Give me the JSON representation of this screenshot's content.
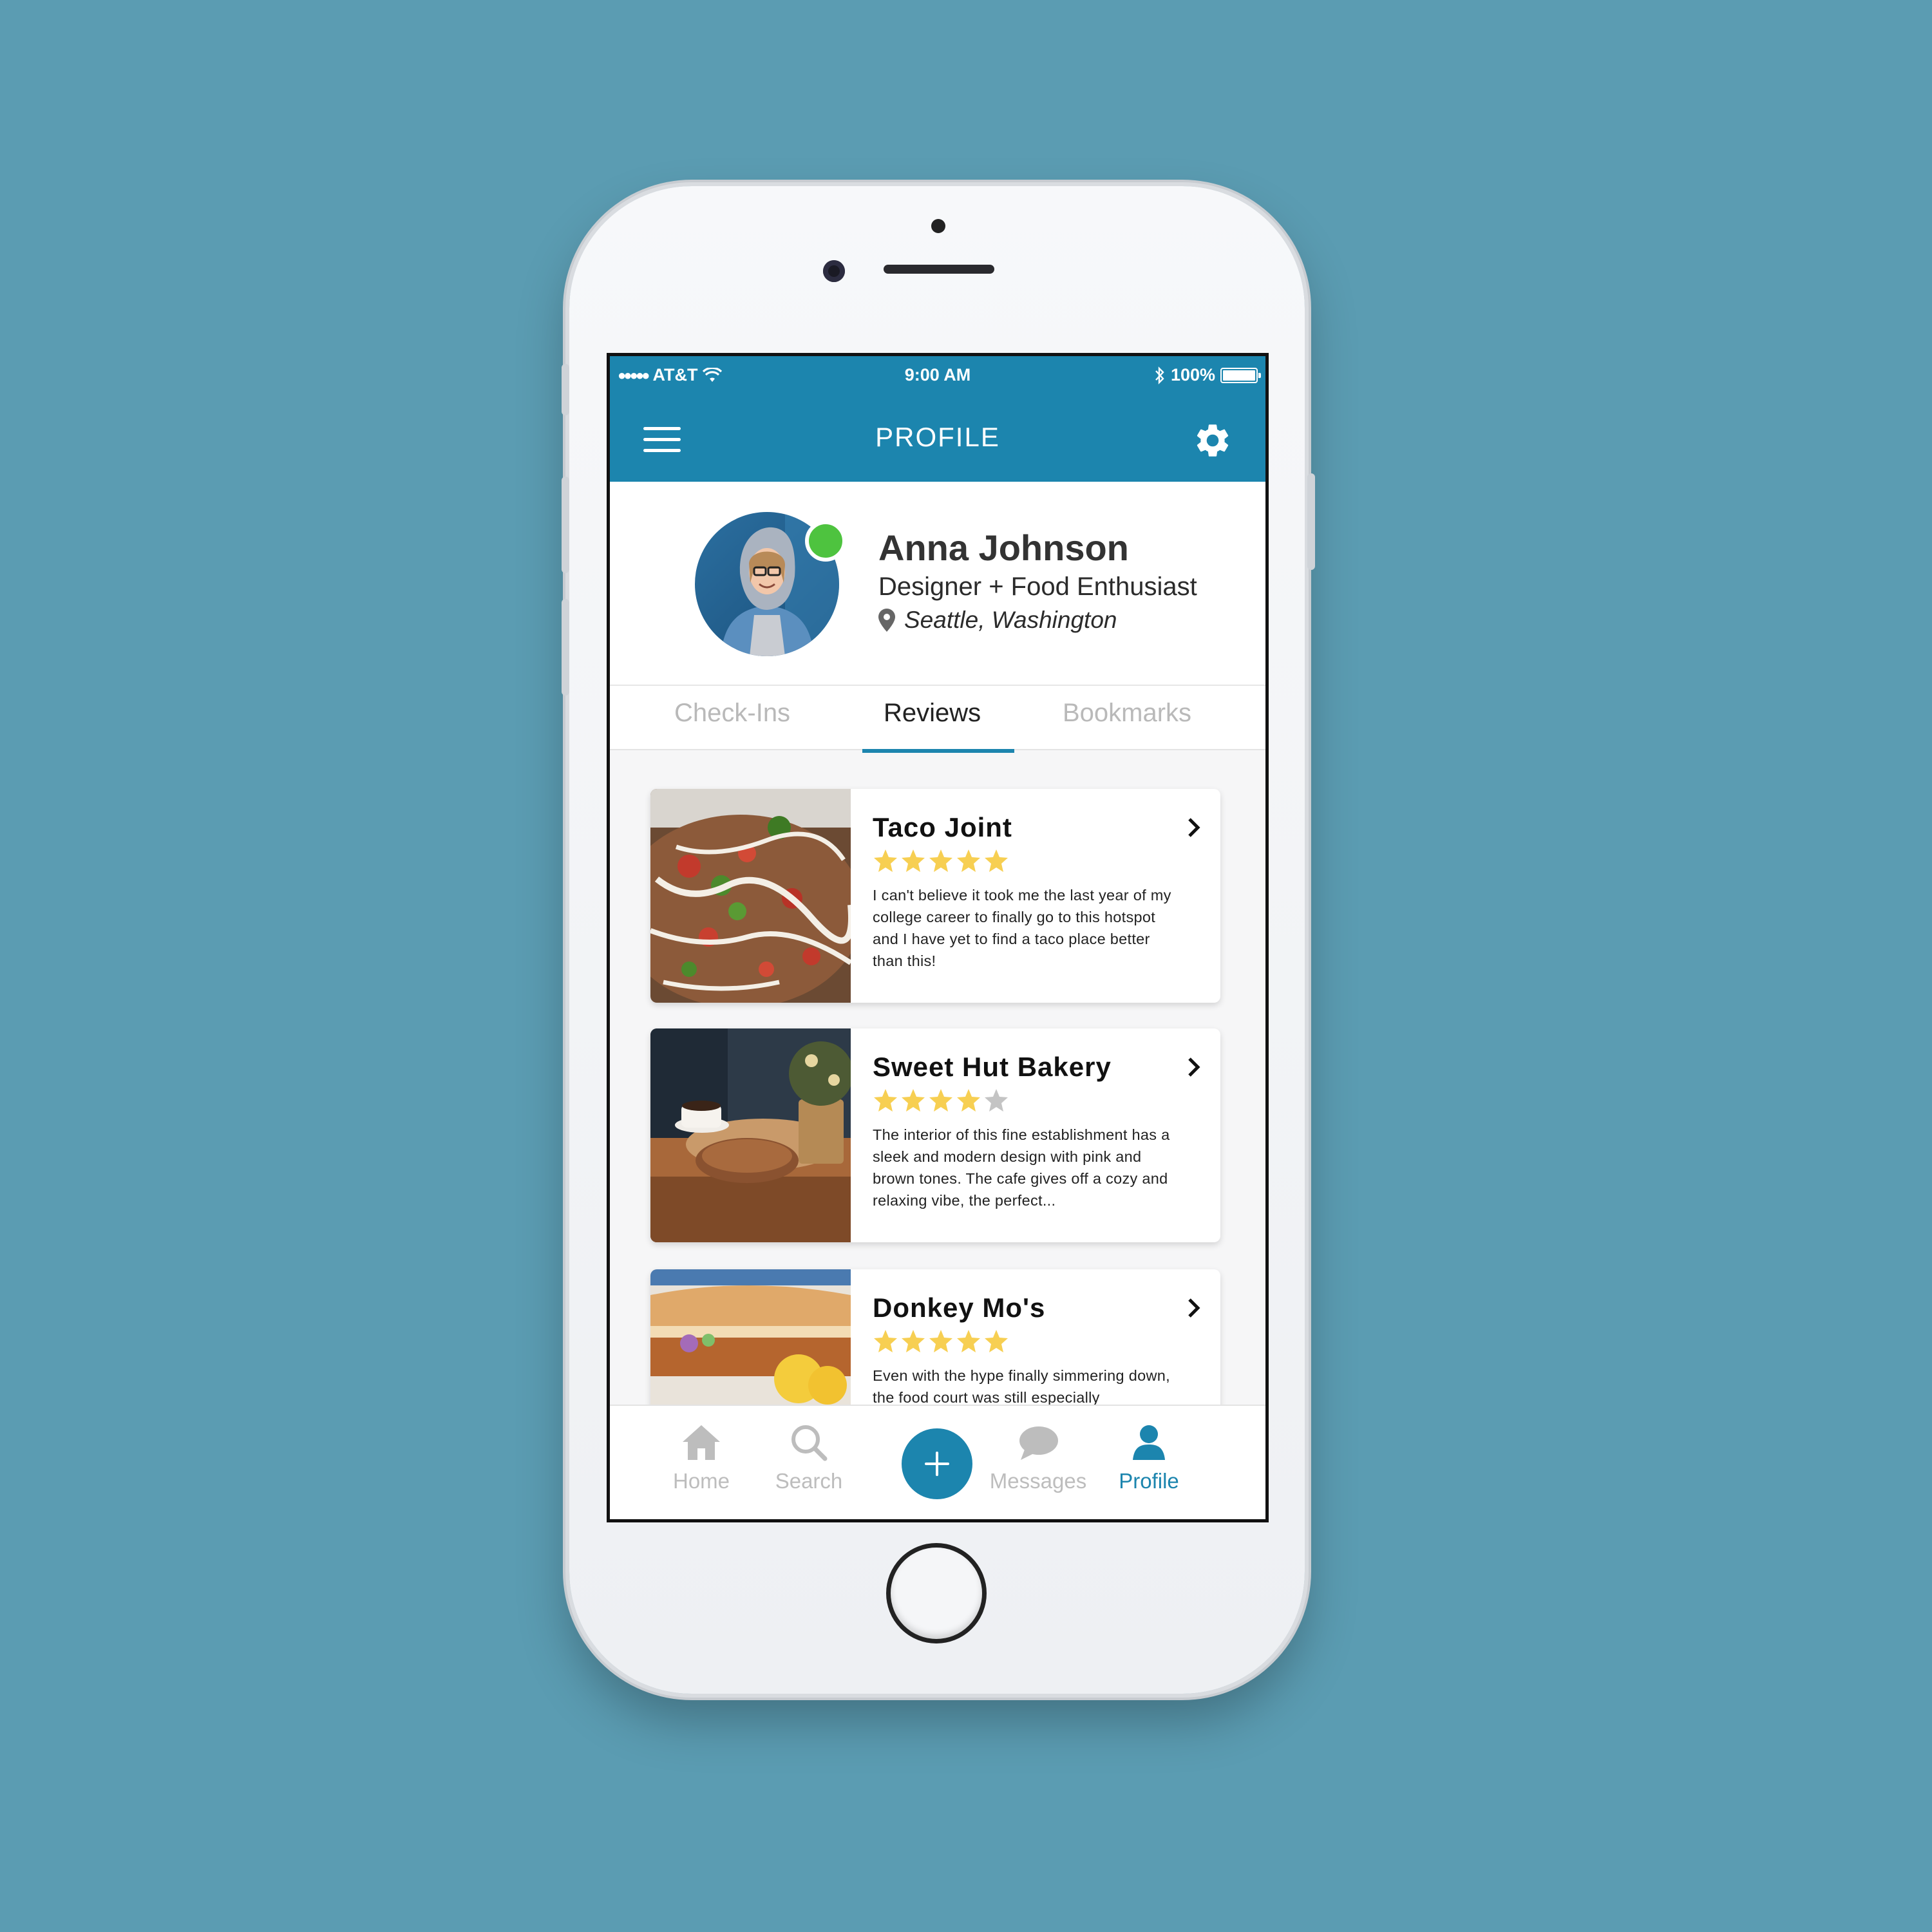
{
  "status_bar": {
    "carrier": "AT&T",
    "time": "9:00 AM",
    "battery_percent": "100%",
    "battery_level": 1.0,
    "signal_icon": "signal-dots-icon",
    "wifi_icon": "wifi-icon",
    "bluetooth_icon": "bluetooth-icon"
  },
  "header": {
    "title": "PROFILE",
    "menu_icon": "hamburger-menu-icon",
    "settings_icon": "gear-icon"
  },
  "profile": {
    "name": "Anna Johnson",
    "bio": "Designer + Food Enthusiast",
    "location": "Seattle, Washington",
    "online": true,
    "online_color": "#4ec33f"
  },
  "tabs": [
    {
      "label": "Check-Ins",
      "active": false
    },
    {
      "label": "Reviews",
      "active": true
    },
    {
      "label": "Bookmarks",
      "active": false
    }
  ],
  "reviews": [
    {
      "title": "Taco Joint",
      "rating": 5,
      "text": "I can't believe it took me the last year of my college career to finally go to this hotspot and I have yet to find a taco place better than this!"
    },
    {
      "title": "Sweet Hut Bakery",
      "rating": 4,
      "text": "The interior of this fine establishment has a sleek and modern design with pink and brown tones. The cafe gives off a cozy and relaxing vibe, the perfect..."
    },
    {
      "title": "Donkey Mo's",
      "rating": 5,
      "text": "Even with the hype finally simmering down, the food court was still especially"
    }
  ],
  "tab_bar": {
    "items": [
      {
        "label": "Home",
        "icon": "home-icon",
        "active": false
      },
      {
        "label": "Search",
        "icon": "search-icon",
        "active": false
      },
      {
        "label": "Messages",
        "icon": "chat-bubble-icon",
        "active": false
      },
      {
        "label": "Profile",
        "icon": "person-icon",
        "active": true
      }
    ],
    "add_icon": "plus-icon"
  },
  "colors": {
    "background": "#5b9cb2",
    "brand": "#1c85ae",
    "star_filled": "#f7cf52",
    "star_empty": "#c4c4c4",
    "tab_inactive": "#bdbdbd"
  }
}
